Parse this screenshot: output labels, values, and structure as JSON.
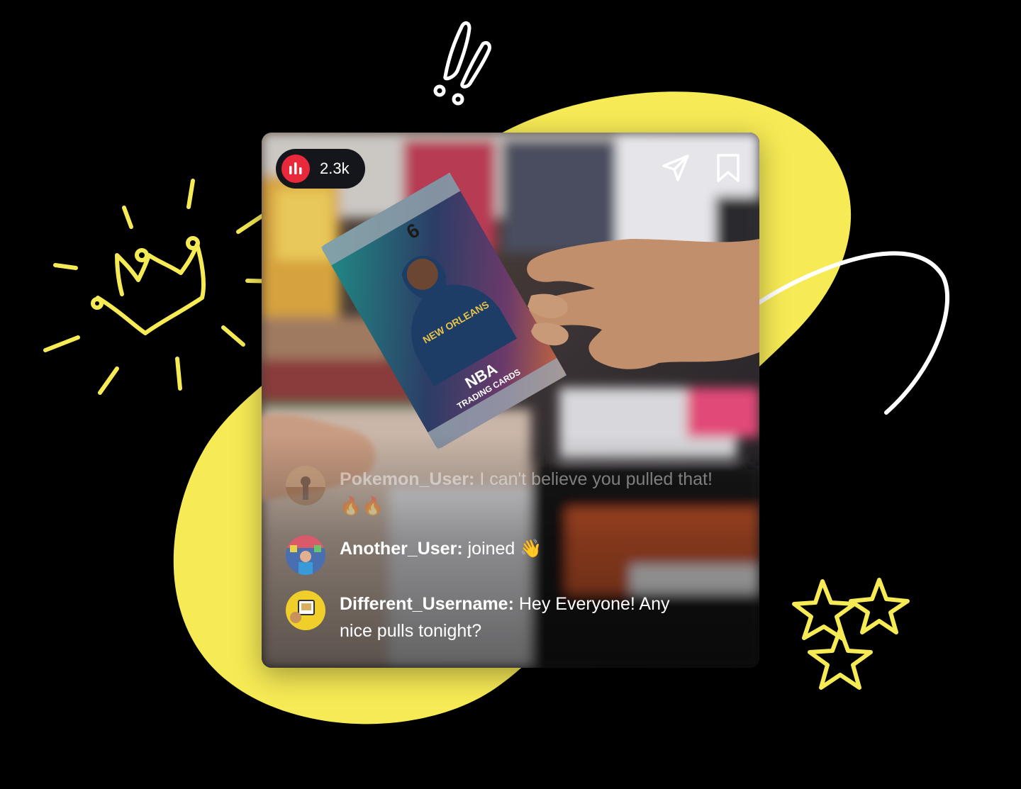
{
  "stream": {
    "viewer_count": "2.3k",
    "icons": {
      "live": "live-bars-icon",
      "share": "send-icon",
      "save": "bookmark-icon"
    }
  },
  "chat": [
    {
      "user": "Pokemon_User:",
      "text": "I can't believe you pulled that! 🔥🔥",
      "avatar": "avatar-pokemon-user"
    },
    {
      "user": "Another_User:",
      "text": "joined 👋",
      "avatar": "avatar-another-user"
    },
    {
      "user": "Different_Username:",
      "text": "Hey Everyone! Any nice pulls tonight?",
      "avatar": "avatar-different-username"
    }
  ],
  "pack": {
    "brand": "NBA",
    "subtitle": "TRADING CARDS",
    "team": "NEW ORLEANS",
    "count": "6"
  },
  "colors": {
    "accent_yellow": "#f6ea55",
    "live_red": "#e8293b",
    "background": "#000000"
  }
}
